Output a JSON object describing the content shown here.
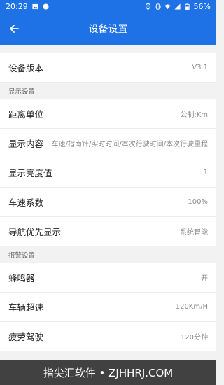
{
  "status_bar": {
    "time": "20:29",
    "battery": "56%",
    "left_icons": [
      "image-icon",
      "circle-icon"
    ],
    "right_icons": [
      "location-icon",
      "vibrate-icon",
      "wifi-icon",
      "signal-icon",
      "battery-icon"
    ]
  },
  "app_bar": {
    "title": "设备设置",
    "back_icon": "back-arrow-icon",
    "color": "#1e72e6"
  },
  "device_version": {
    "label": "设备版本",
    "value": "V3.1"
  },
  "display_section": {
    "header": "显示设置",
    "items": [
      {
        "label": "距离单位",
        "value": "公制:Km"
      },
      {
        "label": "显示内容",
        "value": "车速/指南针/实时时间/本次行驶时间/本次行驶里程"
      },
      {
        "label": "显示亮度值",
        "value": "1"
      },
      {
        "label": "车速系数",
        "value": "100%"
      },
      {
        "label": "导航优先显示",
        "value": "系统智能"
      }
    ]
  },
  "alarm_section": {
    "header": "报警设置",
    "items": [
      {
        "label": "蜂鸣器",
        "value": "开"
      },
      {
        "label": "车辆超速",
        "value": "120Km/H"
      },
      {
        "label": "疲劳驾驶",
        "value": "120分钟"
      }
    ]
  },
  "watermark": {
    "text": "指尖汇软件 • ZJHHRJ.COM"
  }
}
